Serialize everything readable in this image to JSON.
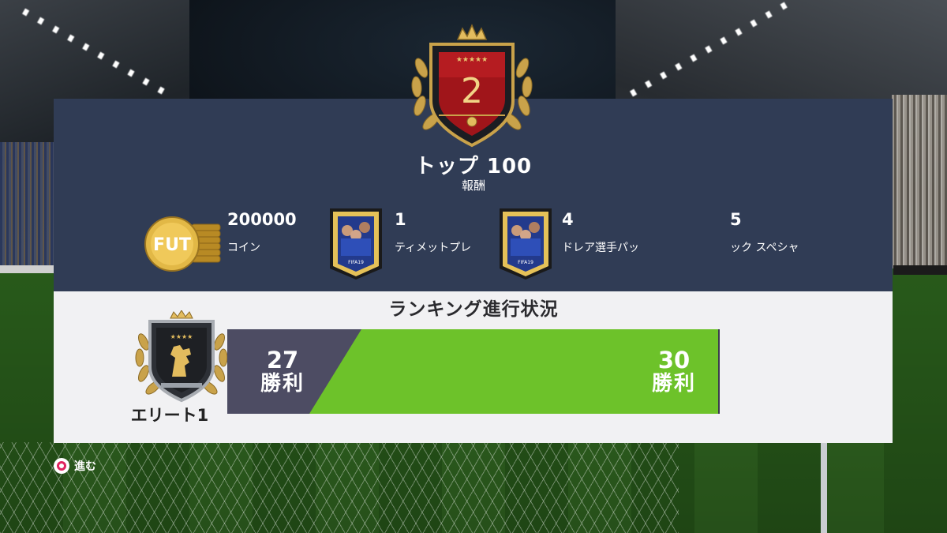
{
  "screen": {
    "rank_number": "2",
    "title": "トップ 100",
    "subtitle": "報酬"
  },
  "rewards": [
    {
      "icon": "fut-coins-icon",
      "quantity": "200000",
      "label": "コイン"
    },
    {
      "icon": "player-pack-icon",
      "quantity": "1",
      "label": "ティメットプレ"
    },
    {
      "icon": "player-pack-icon",
      "quantity": "4",
      "label": "ドレア選手パッ"
    },
    {
      "icon": "player-pack-icon",
      "quantity": "5",
      "label": "ック スペシャ"
    }
  ],
  "pack_text": "FIFA19",
  "progress": {
    "title": "ランキング進行状況",
    "division_label": "エリート1",
    "current_wins": "27",
    "target_wins": "30",
    "unit": "勝利"
  },
  "footer": {
    "continue_label": "進む"
  },
  "colors": {
    "panel_top": "#303c55",
    "panel_bottom": "#f1f1f3",
    "progress_fill": "#6dc22a",
    "progress_start": "#4d4c63",
    "rank_red": "#a0151a",
    "gold": "#d5ad52"
  }
}
